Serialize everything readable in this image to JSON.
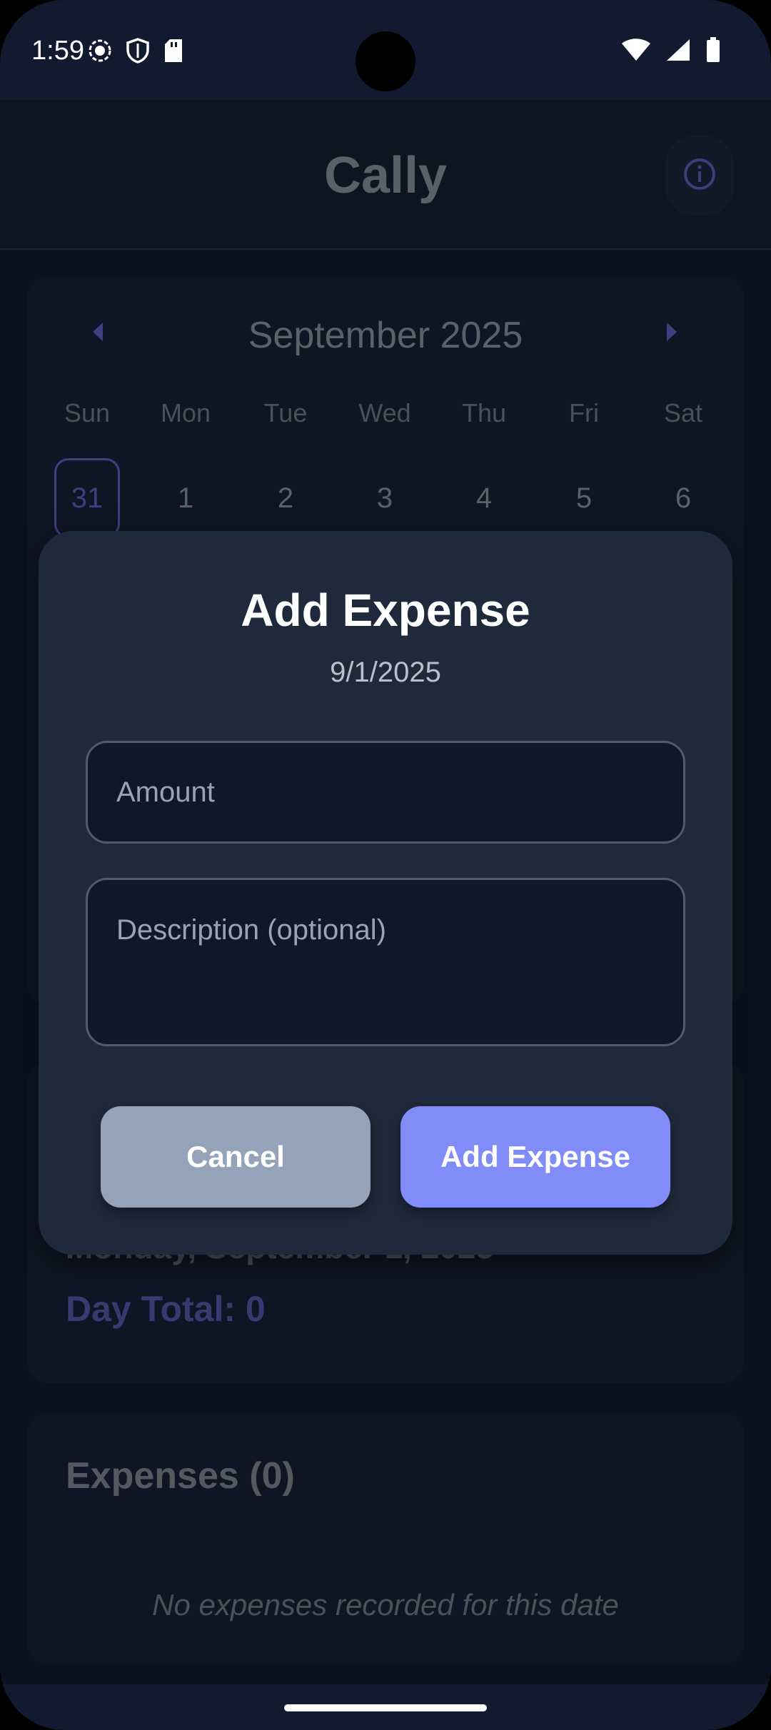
{
  "status_bar": {
    "time": "1:59",
    "icons_left": [
      "screen-record-icon",
      "shield-icon",
      "sd-card-icon"
    ],
    "icons_right": [
      "wifi-icon",
      "cellular-signal-icon",
      "battery-icon"
    ]
  },
  "app": {
    "title": "Cally",
    "info_icon": "info-icon"
  },
  "calendar": {
    "month_label": "September 2025",
    "weekdays": [
      "Sun",
      "Mon",
      "Tue",
      "Wed",
      "Thu",
      "Fri",
      "Sat"
    ],
    "first_week": [
      "31",
      "1",
      "2",
      "3",
      "4",
      "5",
      "6"
    ],
    "selected_day": "31"
  },
  "day_summary": {
    "heading": "Monday, September 1, 2025",
    "total": "Day Total: 0"
  },
  "expenses": {
    "title": "Expenses (0)",
    "empty_message": "No expenses recorded for this date"
  },
  "modal": {
    "title": "Add Expense",
    "date": "9/1/2025",
    "amount_placeholder": "Amount",
    "description_placeholder": "Description (optional)",
    "cancel_label": "Cancel",
    "submit_label": "Add Expense"
  },
  "colors": {
    "modal_bg": "#1e293b",
    "primary": "#818cf8",
    "secondary": "#94a3b8",
    "app_bg": "#0b1120"
  }
}
